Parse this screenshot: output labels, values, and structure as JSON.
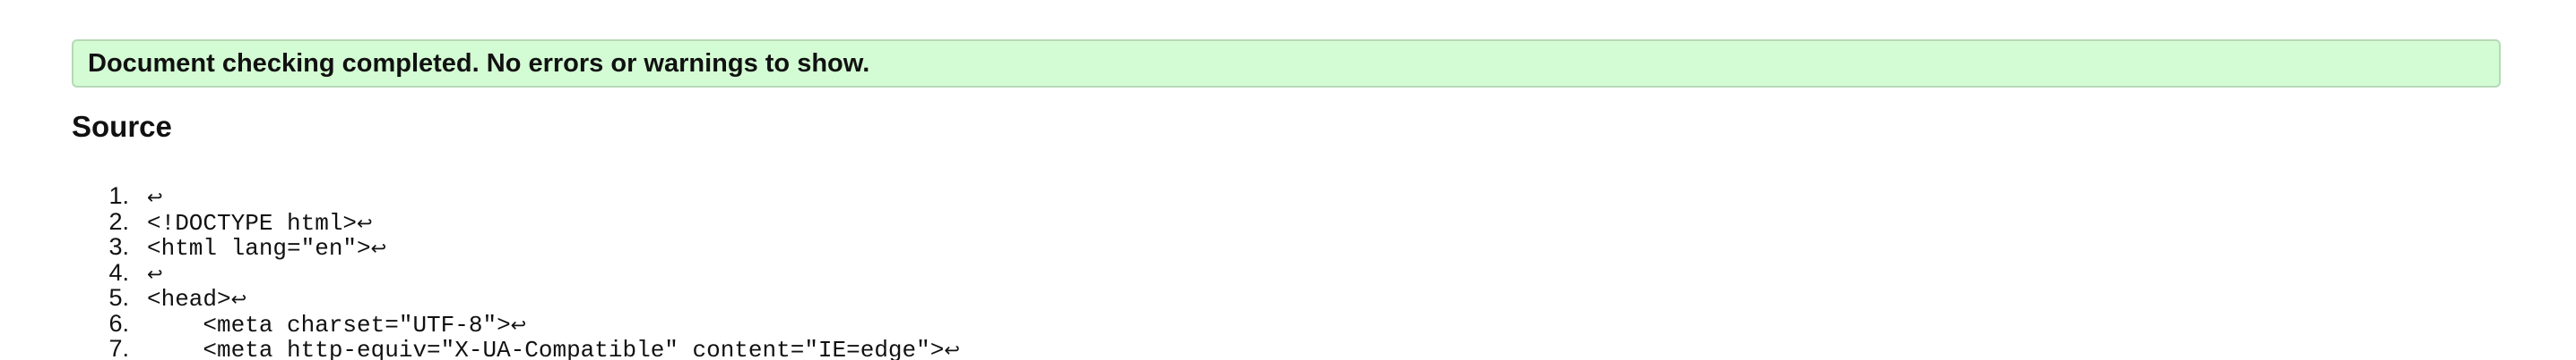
{
  "status": {
    "message": "Document checking completed. No errors or warnings to show."
  },
  "source": {
    "heading": "Source",
    "line_break_glyph": "↩",
    "lines": [
      {
        "number": "1.",
        "code": ""
      },
      {
        "number": "2.",
        "code": "<!DOCTYPE html>"
      },
      {
        "number": "3.",
        "code": "<html lang=\"en\">"
      },
      {
        "number": "4.",
        "code": ""
      },
      {
        "number": "5.",
        "code": "<head>"
      },
      {
        "number": "6.",
        "code": "    <meta charset=\"UTF-8\">"
      },
      {
        "number": "7.",
        "code": "    <meta http-equiv=\"X-UA-Compatible\" content=\"IE=edge\">"
      }
    ]
  },
  "colors": {
    "banner_background": "#d4fcd4",
    "banner_border": "#b6d9b6",
    "text": "#111111"
  }
}
